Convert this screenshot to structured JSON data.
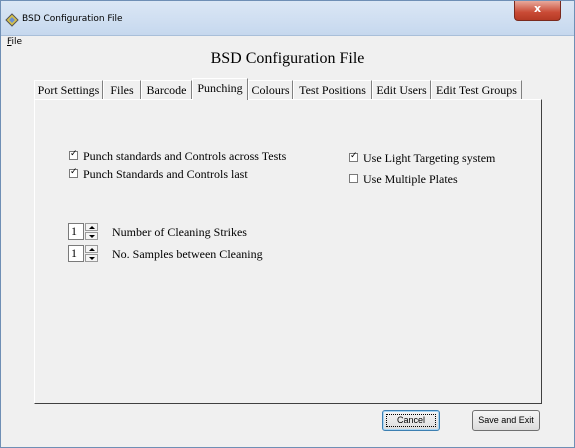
{
  "window": {
    "title": "BSD Configuration File",
    "close_glyph": "x"
  },
  "menu": {
    "file_accel": "F",
    "file_rest": "ile"
  },
  "heading": "BSD Configuration File",
  "tabs": [
    "Port Settings",
    "Files",
    "Barcode",
    "Punching",
    "Colours",
    "Test Positions",
    "Edit Users",
    "Edit Test Groups"
  ],
  "active_tab": "Punching",
  "checks": {
    "punch_across_tests": {
      "label": "Punch standards and Controls across Tests",
      "checked": true
    },
    "punch_last": {
      "label": "Punch Standards and Controls last",
      "checked": true
    },
    "light_targeting": {
      "label": "Use Light Targeting system",
      "checked": true
    },
    "multiple_plates": {
      "label": "Use Multiple Plates",
      "checked": false
    }
  },
  "spinners": {
    "cleaning_strikes": {
      "value": "1",
      "label": "Number of Cleaning Strikes"
    },
    "samples_between": {
      "value": "1",
      "label": "No. Samples between Cleaning"
    }
  },
  "buttons": {
    "cancel": "Cancel",
    "save_exit": "Save and Exit"
  },
  "tick_glyph": "✓"
}
